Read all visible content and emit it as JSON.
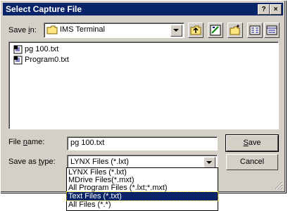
{
  "dialog": {
    "title": "Select Capture File",
    "help_glyph": "?",
    "close_glyph": "×"
  },
  "lookin": {
    "label_prefix": "Save ",
    "label_underline": "i",
    "label_suffix": "n:",
    "value": "IMS Terminal"
  },
  "toolbar": {
    "icons": [
      "up-one-level-icon",
      "desktop-icon",
      "new-folder-icon",
      "list-view-icon",
      "details-view-icon"
    ]
  },
  "files": [
    {
      "name": "pg 100.txt",
      "icon": "text-file-icon"
    },
    {
      "name": "Program0.txt",
      "icon": "text-file-icon"
    }
  ],
  "filename": {
    "label_prefix": "File ",
    "label_underline": "n",
    "label_suffix": "ame:",
    "value": "pg 100.txt"
  },
  "savetype": {
    "label_prefix": "Save as ",
    "label_underline": "t",
    "label_suffix": "ype:",
    "value": "LYNX Files (*.lxt)",
    "options": [
      "LYNX Files (*.lxt)",
      "MDrive Files(*.mxt)",
      "All Program Files (*.lxt;*.mxt)",
      "Text Files (*.txt)",
      "All Files (*.*)"
    ],
    "highlighted_index": 3
  },
  "buttons": {
    "save_underline": "S",
    "save_rest": "ave",
    "cancel": "Cancel"
  },
  "colors": {
    "titlebar": "#0a246a",
    "face": "#d4d0c8"
  }
}
